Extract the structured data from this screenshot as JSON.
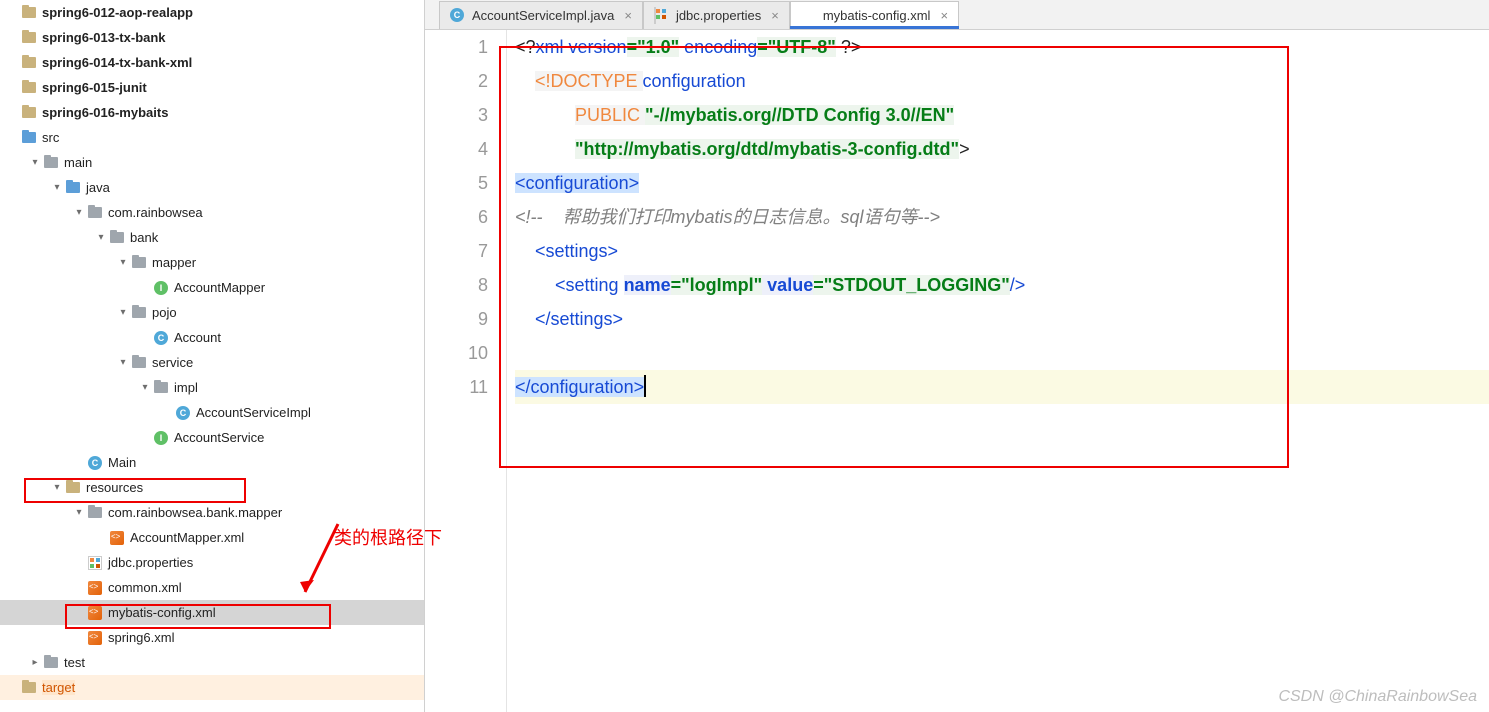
{
  "tree": [
    {
      "indent": 0,
      "arrow": "",
      "icon": "folder",
      "label": "spring6-012-aop-realapp",
      "bold": true
    },
    {
      "indent": 0,
      "arrow": "",
      "icon": "folder",
      "label": "spring6-013-tx-bank",
      "bold": true
    },
    {
      "indent": 0,
      "arrow": "",
      "icon": "folder",
      "label": "spring6-014-tx-bank-xml",
      "bold": true
    },
    {
      "indent": 0,
      "arrow": "",
      "icon": "folder",
      "label": "spring6-015-junit",
      "bold": true
    },
    {
      "indent": 0,
      "arrow": "",
      "icon": "folder",
      "label": "spring6-016-mybaits",
      "bold": true
    },
    {
      "indent": 0,
      "arrow": "",
      "icon": "folder-blue",
      "label": "src"
    },
    {
      "indent": 1,
      "arrow": "v",
      "icon": "folder-grey",
      "label": "main"
    },
    {
      "indent": 2,
      "arrow": "v",
      "icon": "folder-blue",
      "label": "java"
    },
    {
      "indent": 3,
      "arrow": "v",
      "icon": "folder-grey",
      "label": "com.rainbowsea"
    },
    {
      "indent": 4,
      "arrow": "v",
      "icon": "folder-grey",
      "label": "bank"
    },
    {
      "indent": 5,
      "arrow": "v",
      "icon": "folder-grey",
      "label": "mapper"
    },
    {
      "indent": 6,
      "arrow": "",
      "icon": "circle-i",
      "label": "AccountMapper"
    },
    {
      "indent": 5,
      "arrow": "v",
      "icon": "folder-grey",
      "label": "pojo"
    },
    {
      "indent": 6,
      "arrow": "",
      "icon": "circle-c",
      "label": "Account"
    },
    {
      "indent": 5,
      "arrow": "v",
      "icon": "folder-grey",
      "label": "service"
    },
    {
      "indent": 6,
      "arrow": "v",
      "icon": "folder-grey",
      "label": "impl"
    },
    {
      "indent": 7,
      "arrow": "",
      "icon": "circle-c",
      "label": "AccountServiceImpl"
    },
    {
      "indent": 6,
      "arrow": "",
      "icon": "circle-i",
      "label": "AccountService"
    },
    {
      "indent": 3,
      "arrow": "",
      "icon": "circle-c",
      "label": "Main"
    },
    {
      "indent": 2,
      "arrow": "v",
      "icon": "folder",
      "label": "resources"
    },
    {
      "indent": 3,
      "arrow": "v",
      "icon": "folder-grey",
      "label": "com.rainbowsea.bank.mapper"
    },
    {
      "indent": 4,
      "arrow": "",
      "icon": "xml",
      "label": "AccountMapper.xml"
    },
    {
      "indent": 3,
      "arrow": "",
      "icon": "prop",
      "label": "jdbc.properties"
    },
    {
      "indent": 3,
      "arrow": "",
      "icon": "xml",
      "label": "common.xml"
    },
    {
      "indent": 3,
      "arrow": "",
      "icon": "xml",
      "label": "mybatis-config.xml",
      "sel": true
    },
    {
      "indent": 3,
      "arrow": "",
      "icon": "xml",
      "label": "spring6.xml"
    },
    {
      "indent": 1,
      "arrow": ">",
      "icon": "folder-grey",
      "label": "test"
    },
    {
      "indent": 0,
      "arrow": "",
      "icon": "folder",
      "label": "target",
      "orange": true
    }
  ],
  "annot_label": "类的根路径下",
  "tabs": [
    {
      "icon": "circle-c",
      "label": "AccountServiceImpl.java",
      "active": false
    },
    {
      "icon": "prop",
      "label": "jdbc.properties",
      "active": false
    },
    {
      "icon": "xml",
      "label": "mybatis-config.xml",
      "active": true
    }
  ],
  "code": {
    "l1": {
      "a": "<?",
      "b": "xml version",
      "c": "=\"1.0\"",
      "d": " encoding",
      "e": "=\"UTF-8\"",
      "f": " ?>"
    },
    "l2": {
      "a": "<!DOCTYPE ",
      "b": "configuration"
    },
    "l3": {
      "a": "PUBLIC ",
      "b": "\"-//mybatis.org//DTD Config 3.0//EN\""
    },
    "l4": {
      "a": "\"http://mybatis.org/dtd/mybatis-3-config.dtd\"",
      "b": ">"
    },
    "l5": {
      "a": "<configuration>"
    },
    "l6": {
      "a": "<!--    帮助我们打印mybatis的日志信息。sql语句等-->"
    },
    "l7": {
      "a": "<settings>"
    },
    "l8": {
      "a": "<setting ",
      "b": "name",
      "c": "=\"logImpl\"",
      "d": " value",
      "e": "=\"STDOUT_LOGGING\"",
      "f": "/>"
    },
    "l9": {
      "a": "</settings>"
    },
    "l11": {
      "a": "</configuration>"
    }
  },
  "line_numbers": [
    "1",
    "2",
    "3",
    "4",
    "5",
    "6",
    "7",
    "8",
    "9",
    "10",
    "11"
  ],
  "watermark": "CSDN @ChinaRainbowSea"
}
